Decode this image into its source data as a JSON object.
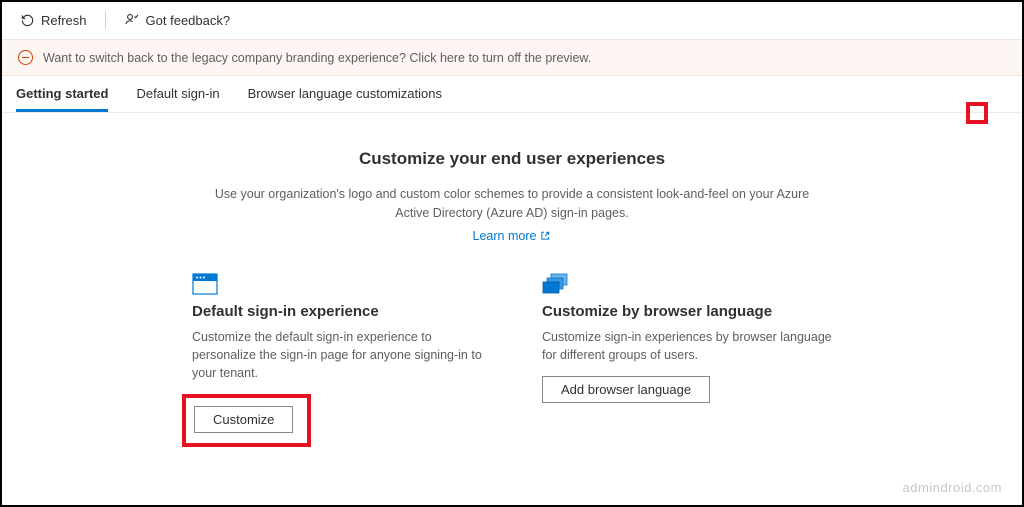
{
  "toolbar": {
    "refresh_label": "Refresh",
    "feedback_label": "Got feedback?"
  },
  "info_bar": {
    "text": "Want to switch back to the legacy company branding experience? Click here to turn off the preview."
  },
  "tabs": {
    "getting_started": "Getting started",
    "default_signin": "Default sign-in",
    "browser_lang": "Browser language customizations"
  },
  "main": {
    "headline": "Customize your end user experiences",
    "description": "Use your organization's logo and custom color schemes to provide a consistent look-and-feel on your Azure Active Directory (Azure AD) sign-in pages.",
    "learn_more": "Learn more"
  },
  "cards": {
    "default": {
      "title": "Default sign-in experience",
      "desc": "Customize the default sign-in experience to personalize the sign-in page for anyone signing-in to your tenant.",
      "button": "Customize"
    },
    "browser": {
      "title": "Customize by browser language",
      "desc": "Customize sign-in experiences by browser language for different groups of users.",
      "button": "Add browser language"
    }
  },
  "watermark": "admindroid.com"
}
